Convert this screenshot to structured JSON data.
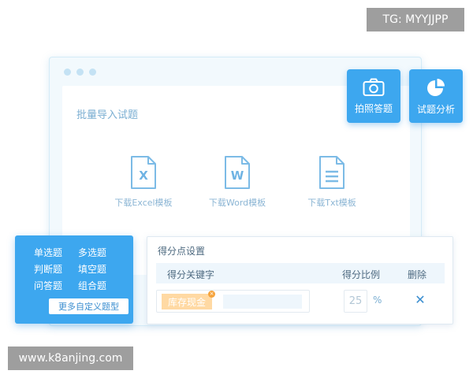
{
  "watermarks": {
    "top": "TG: MYYJJPP",
    "bottom": "www.k8anjing.com"
  },
  "import_panel": {
    "title": "批量导入试题",
    "templates": [
      {
        "icon": "excel-file-icon",
        "glyph": "X",
        "label": "下载Excel模板"
      },
      {
        "icon": "word-file-icon",
        "glyph": "W",
        "label": "下载Word模板"
      },
      {
        "icon": "txt-file-icon",
        "glyph": "",
        "label": "下载Txt模板"
      }
    ]
  },
  "tiles": [
    {
      "icon": "camera-icon",
      "label": "拍照答题"
    },
    {
      "icon": "pie-chart-icon",
      "label": "试题分析"
    }
  ],
  "question_types": {
    "items": [
      "单选题",
      "多选题",
      "判断题",
      "填空题",
      "问答题",
      "组合题"
    ],
    "more_button": "更多自定义题型"
  },
  "score_settings": {
    "title": "得分点设置",
    "columns": {
      "keyword": "得分关键字",
      "ratio": "得分比例",
      "delete": "删除"
    },
    "row": {
      "keyword_tag": "库存现金",
      "keyword_input": "",
      "ratio_value": "25",
      "percent": "%",
      "delete_symbol": "✕"
    }
  },
  "colors": {
    "primary": "#3da7ef",
    "tag": "#ffd9a3",
    "tag_badge": "#f5a33c",
    "panel_bg": "#f2f9fd",
    "watermark_bg": "#9e9e9e"
  }
}
